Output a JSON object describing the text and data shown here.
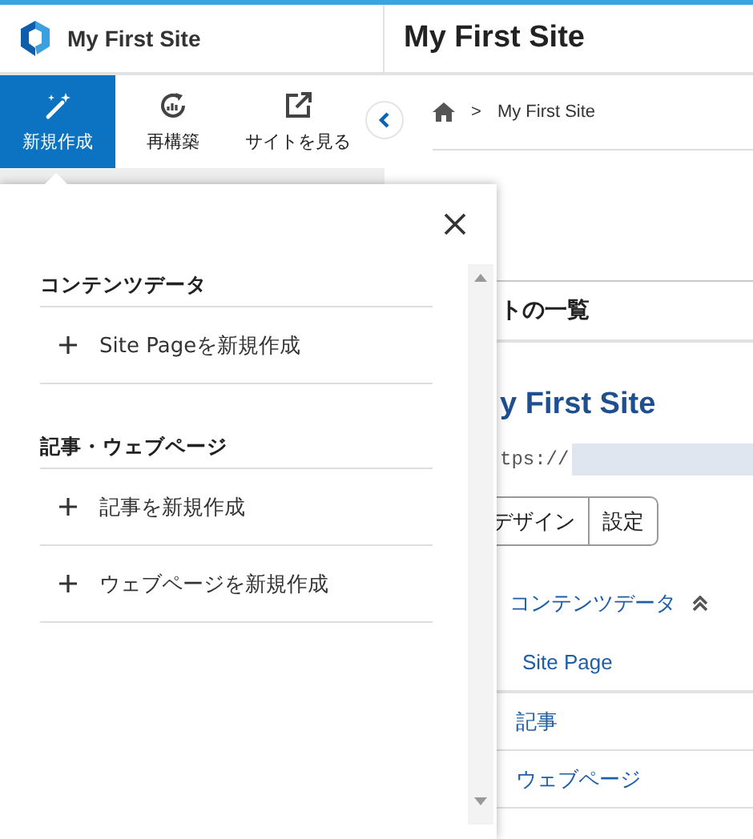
{
  "header": {
    "site_name": "My First Site",
    "page_title": "My First Site"
  },
  "toolbar": [
    {
      "label": "新規作成",
      "kind": "wand",
      "selected": true
    },
    {
      "label": "再構築",
      "kind": "rebuild",
      "selected": false
    },
    {
      "label": "サイトを見る",
      "kind": "external",
      "selected": false
    }
  ],
  "breadcrumb": [
    {
      "separator": ">",
      "label": "My First Site"
    }
  ],
  "popup": {
    "sections": [
      {
        "title": "コンテンツデータ",
        "items": [
          "Site Pageを新規作成"
        ]
      },
      {
        "title": "記事・ウェブページ",
        "items": [
          "記事を新規作成",
          "ウェブページを新規作成"
        ]
      }
    ]
  },
  "content": {
    "section_title": "トの一覧",
    "site_title": "y First Site",
    "url": "tps://",
    "buttons": [
      "デザイン",
      "設定"
    ],
    "tree": [
      {
        "label": "コンテンツデータ",
        "expanded": true,
        "children": [
          {
            "label": "Site Page"
          }
        ]
      },
      {
        "label": "記事"
      },
      {
        "label": "ウェブページ"
      }
    ]
  }
}
